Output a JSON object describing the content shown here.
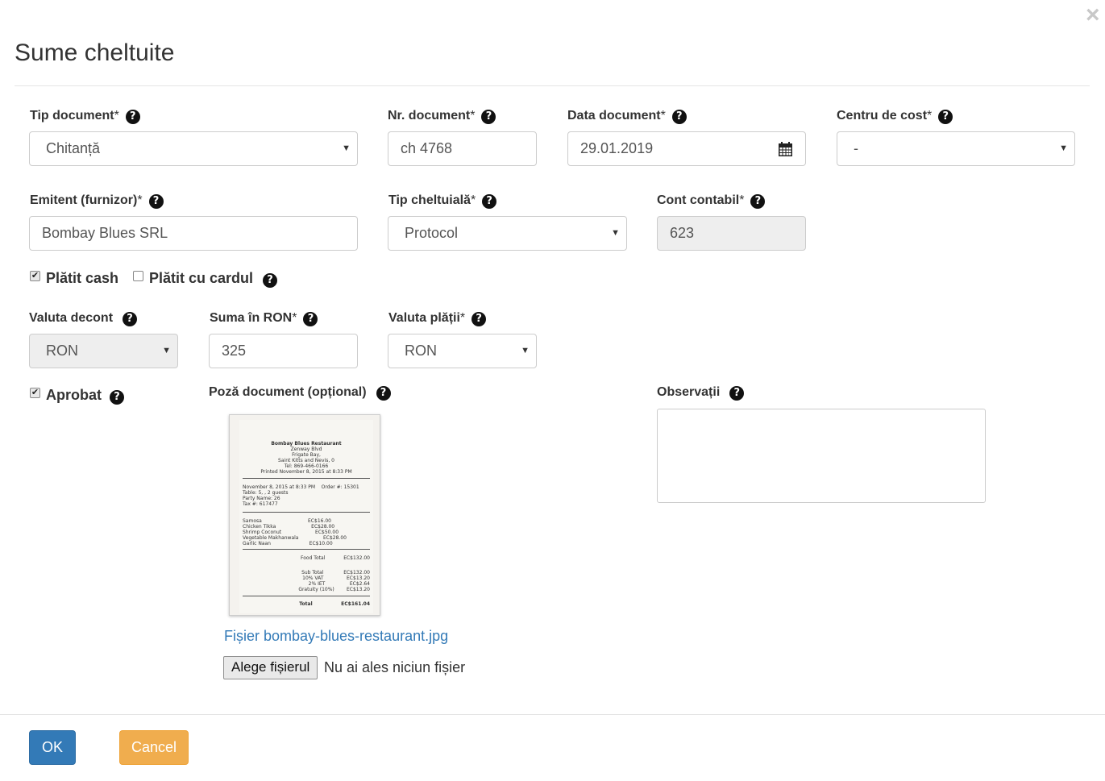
{
  "dialog": {
    "title": "Sume cheltuite",
    "close_glyph": "×"
  },
  "fields": {
    "tip_document": {
      "label": "Tip document",
      "required": "*",
      "value": "Chitanță"
    },
    "nr_document": {
      "label": "Nr. document",
      "required": "*",
      "value": "ch 4768"
    },
    "data_document": {
      "label": "Data document",
      "required": "*",
      "value": "29.01.2019",
      "icon": "calendar-icon"
    },
    "centru_cost": {
      "label": "Centru de cost",
      "required": "*",
      "value": "-"
    },
    "emitent": {
      "label": "Emitent (furnizor)",
      "required": "*",
      "value": "Bombay Blues SRL"
    },
    "tip_cheltuiala": {
      "label": "Tip cheltuială",
      "required": "*",
      "value": "Protocol"
    },
    "cont_contabil": {
      "label": "Cont contabil",
      "required": "*",
      "value": "623"
    },
    "platit_cash": {
      "label": "Plătit cash",
      "checked": true
    },
    "platit_card": {
      "label": "Plătit cu cardul",
      "checked": false
    },
    "valuta_decont": {
      "label": "Valuta decont",
      "value": "RON"
    },
    "suma_ron": {
      "label": "Suma în RON",
      "required": "*",
      "value": "325"
    },
    "valuta_platii": {
      "label": "Valuta plății",
      "required": "*",
      "value": "RON"
    },
    "aprobat": {
      "label": "Aprobat",
      "checked": true
    },
    "poza": {
      "label": "Poză document (opțional)",
      "file_link": "Fișier bombay-blues-restaurant.jpg",
      "choose_button": "Alege fișierul",
      "no_file_text": "Nu ai ales niciun fișier"
    },
    "observatii": {
      "label": "Observații",
      "value": ""
    }
  },
  "receipt": {
    "lines": [
      "Bombay Blues Restaurant",
      "Zenway Blvd",
      "Frigate Bay,",
      "Saint Kitts and Nevis, 0",
      "Tel: 869-466-0166",
      "Printed November 8, 2015 at 8:33 PM",
      "November 8, 2015 at 8:33 PM    Order #: 15301",
      "Table: 5, , 2 guests",
      "Party Name: 26",
      "Tax #: 617477",
      "Samosa                              EC$16.00",
      "Chicken Tikka                       EC$28.00",
      "Shrimp Coconut                      EC$50.00",
      "Vegetable Makhanwala                EC$28.00",
      "Garlic Naan                         EC$10.00",
      "Food Total            EC$132.00",
      "Sub Total             EC$132.00",
      "10% VAT               EC$13.20",
      "2% IET                EC$2.64",
      "Gratuity (10%)        EC$13.20",
      "Total                 EC$161.04"
    ]
  },
  "help_glyph": "?",
  "caret_glyph": "▼",
  "check_glyph": "✔",
  "buttons": {
    "ok": "OK",
    "cancel": "Cancel"
  },
  "colors": {
    "primary": "#337ab7",
    "warning": "#f0ad4e",
    "link": "#337ab7"
  }
}
